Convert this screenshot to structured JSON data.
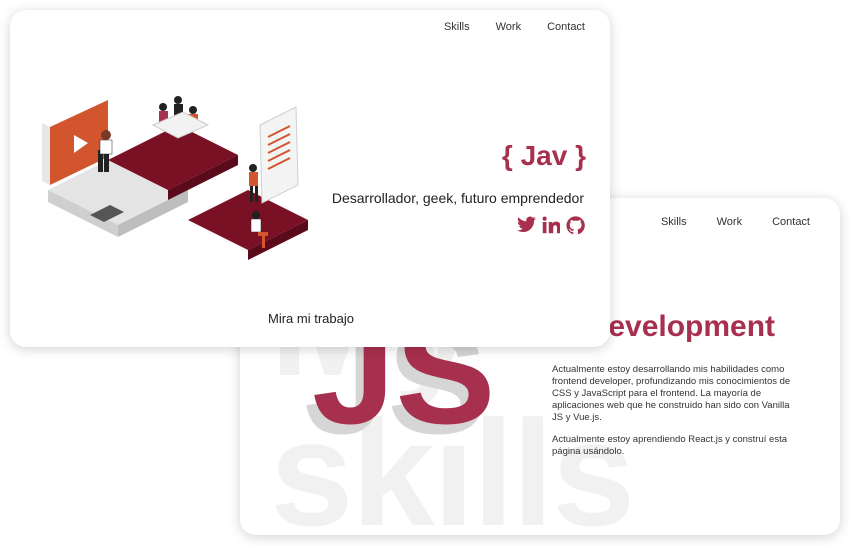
{
  "colors": {
    "accent": "#a8304f",
    "dark_red": "#7a1024",
    "orange": "#d2552e"
  },
  "front": {
    "nav": [
      "Skills",
      "Work",
      "Contact"
    ],
    "logo": "{ Jav }",
    "tagline": "Desarrollador, geek, futuro emprendedor",
    "socials": [
      "twitter-icon",
      "linkedin-icon",
      "github-icon"
    ],
    "cta": "Mira mi trabajo"
  },
  "back": {
    "nav": [
      "Skills",
      "Work",
      "Contact"
    ],
    "watermark": "My skills",
    "js": "JS",
    "subtitle": "lls",
    "title": "development",
    "paragraphs": [
      "Actualmente estoy desarrollando mis habilidades como frontend developer, profundizando mis conocimientos de CSS y JavaScript para el frontend. La mayoría de aplicaciones web que he construido han sido con Vanilla JS y Vue.js.",
      "Actualmente estoy aprendiendo React.js y construí esta página usándolo."
    ]
  }
}
